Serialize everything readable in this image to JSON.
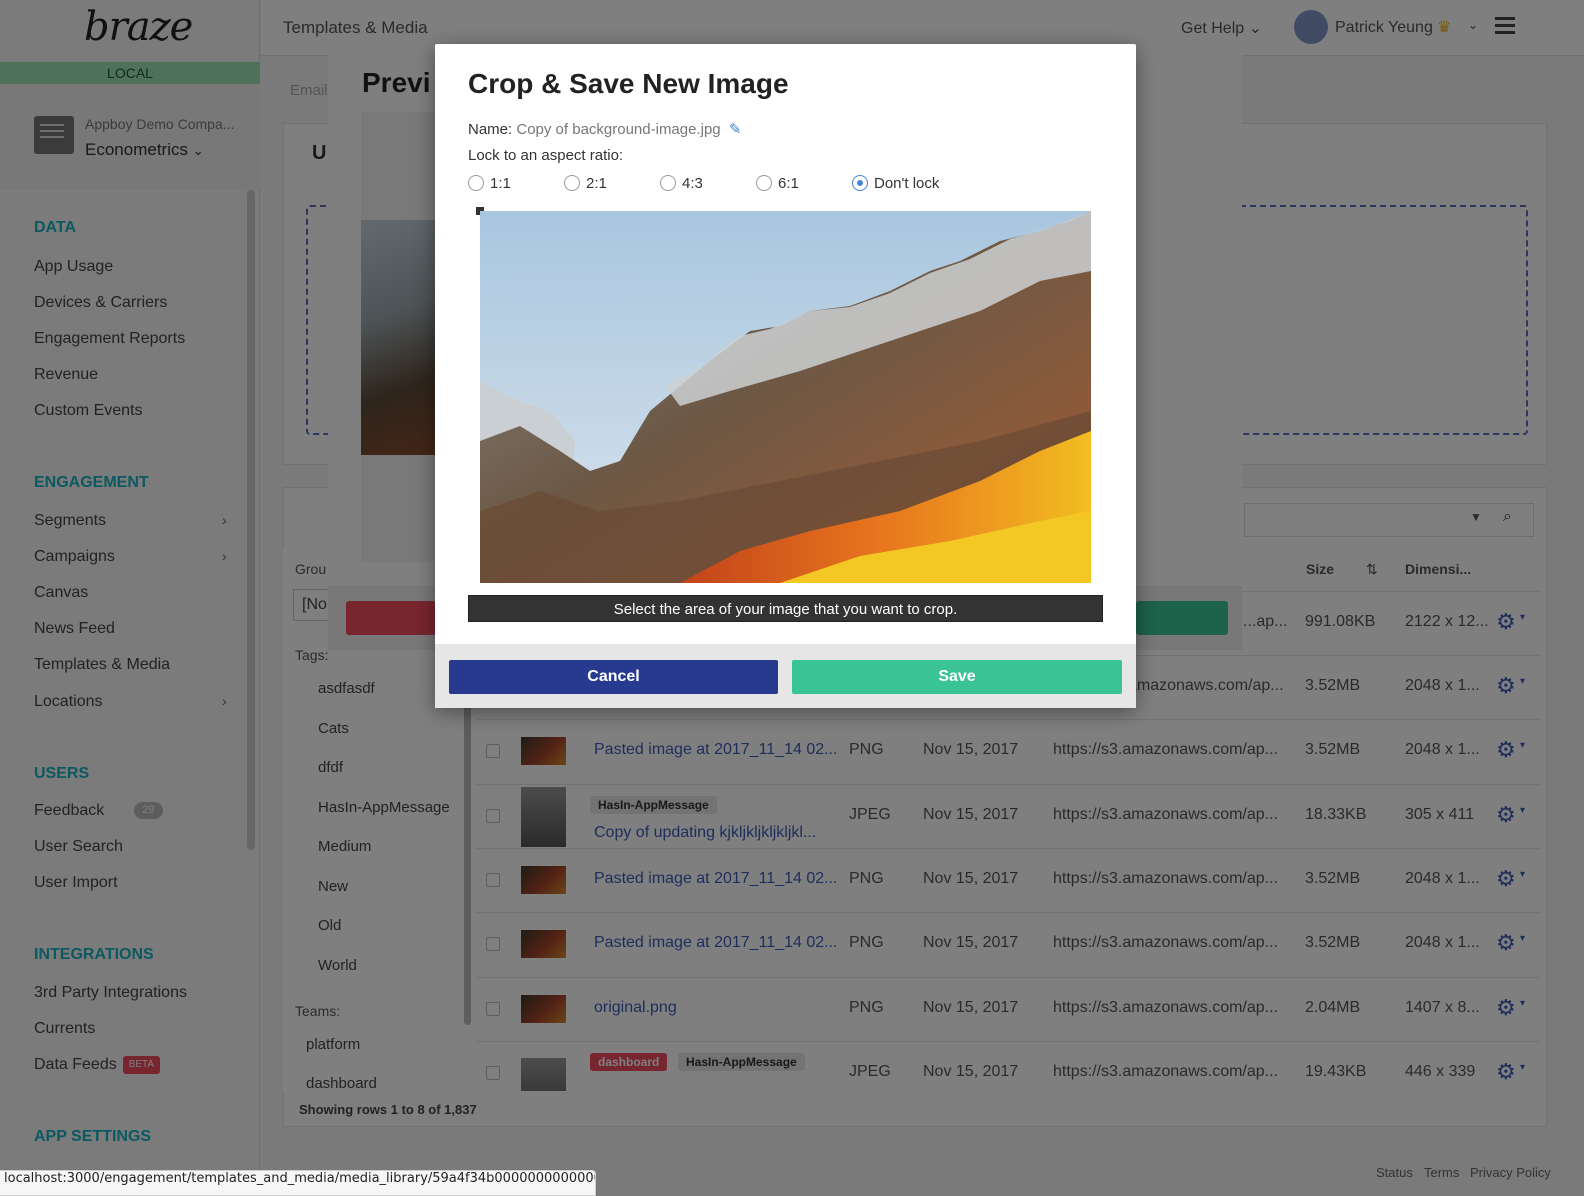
{
  "app": {
    "logo": "braze",
    "environment": "LOCAL",
    "company_sub": "Appboy Demo Compa...",
    "company_name": "Econometrics",
    "chevron": "⌄"
  },
  "sidebar": {
    "sections": [
      {
        "title": "DATA",
        "items": [
          {
            "label": "App Usage"
          },
          {
            "label": "Devices & Carriers"
          },
          {
            "label": "Engagement Reports"
          },
          {
            "label": "Revenue"
          },
          {
            "label": "Custom Events"
          }
        ]
      },
      {
        "title": "ENGAGEMENT",
        "items": [
          {
            "label": "Segments",
            "chevron": "›"
          },
          {
            "label": "Campaigns",
            "chevron": "›"
          },
          {
            "label": "Canvas"
          },
          {
            "label": "News Feed"
          },
          {
            "label": "Templates & Media"
          },
          {
            "label": "Locations",
            "chevron": "›"
          }
        ]
      },
      {
        "title": "USERS",
        "items": [
          {
            "label": "Feedback",
            "badge": "29"
          },
          {
            "label": "User Search"
          },
          {
            "label": "User Import"
          }
        ]
      },
      {
        "title": "INTEGRATIONS",
        "items": [
          {
            "label": "3rd Party Integrations"
          },
          {
            "label": "Currents"
          },
          {
            "label": "Data Feeds",
            "badge": "BETA"
          }
        ]
      },
      {
        "title": "APP SETTINGS",
        "items": []
      }
    ]
  },
  "header": {
    "title": "Templates & Media",
    "get_help": "Get Help ⌄",
    "user_name": "Patrick Yeung",
    "crown_icon": "♛",
    "user_chevron": "⌄"
  },
  "background_page": {
    "email_tab": "Email",
    "preview_title": "Previ",
    "upload_fragment": "U",
    "group_label": "Grou",
    "group_value": "[No",
    "tags_label": "Tags:",
    "tags": [
      "asdfasdf",
      "Cats",
      "dfdf",
      "HasIn-AppMessage",
      "Medium",
      "New",
      "Old",
      "World"
    ],
    "teams_label": "Teams:",
    "teams": [
      "platform",
      "dashboard"
    ],
    "columns": {
      "size": "Size",
      "size_sort_icon": "⇅",
      "dimensions": "Dimensi..."
    },
    "rows": [
      {
        "name": "",
        "type": "",
        "date": "",
        "url": "...ap...",
        "size": "991.08KB",
        "dim": "2122 x 12...",
        "thumb": "none"
      },
      {
        "name": "",
        "type": "",
        "date": "",
        "url": "amazonaws.com/ap...",
        "size": "3.52MB",
        "dim": "2048 x 1...",
        "thumb": "none"
      },
      {
        "name": "Pasted image at 2017_11_14 02...",
        "type": "PNG",
        "date": "Nov 15, 2017",
        "url": "https://s3.amazonaws.com/ap...",
        "size": "3.52MB",
        "dim": "2048 x 1...",
        "thumb": "color"
      },
      {
        "name": "Copy of updating kjkljkljkljkljkl...",
        "tag1": "HasIn-AppMessage",
        "type": "JPEG",
        "date": "Nov 15, 2017",
        "url": "https://s3.amazonaws.com/ap...",
        "size": "18.33KB",
        "dim": "305 x 411",
        "thumb": "gray"
      },
      {
        "name": "Pasted image at 2017_11_14 02...",
        "type": "PNG",
        "date": "Nov 15, 2017",
        "url": "https://s3.amazonaws.com/ap...",
        "size": "3.52MB",
        "dim": "2048 x 1...",
        "thumb": "color"
      },
      {
        "name": "Pasted image at 2017_11_14 02...",
        "type": "PNG",
        "date": "Nov 15, 2017",
        "url": "https://s3.amazonaws.com/ap...",
        "size": "3.52MB",
        "dim": "2048 x 1...",
        "thumb": "color"
      },
      {
        "name": "original.png",
        "type": "PNG",
        "date": "Nov 15, 2017",
        "url": "https://s3.amazonaws.com/ap...",
        "size": "2.04MB",
        "dim": "1407 x 8...",
        "thumb": "color"
      },
      {
        "name": "",
        "tag1": "dashboard",
        "tag2": "HasIn-AppMessage",
        "type": "JPEG",
        "date": "Nov 15, 2017",
        "url": "https://s3.amazonaws.com/ap...",
        "size": "19.43KB",
        "dim": "446 x 339",
        "thumb": "gray"
      }
    ],
    "gear_icon": "⚙",
    "gear_chevron": "▾",
    "showing": "Showing rows 1 to 8 of 1,837"
  },
  "footer": {
    "status": "Status",
    "terms": "Terms",
    "privacy": "Privacy Policy"
  },
  "status_url": "localhost:3000/engagement/templates_and_media/media_library/59a4f34b0000000000000000#",
  "modal": {
    "title": "Crop & Save New Image",
    "name_label": "Name:",
    "name_value": "Copy of background-image.jpg",
    "pencil_icon": "✎",
    "lock_label": "Lock to an aspect ratio:",
    "ratios": [
      {
        "label": "1:1",
        "selected": false
      },
      {
        "label": "2:1",
        "selected": false
      },
      {
        "label": "4:3",
        "selected": false
      },
      {
        "label": "6:1",
        "selected": false
      },
      {
        "label": "Don't lock",
        "selected": true
      }
    ],
    "hint": "Select the area of your image that you want to crop.",
    "cancel_label": "Cancel",
    "save_label": "Save"
  },
  "colors": {
    "accent_teal": "#17b3c3",
    "cancel_blue": "#283a8f",
    "save_green": "#3ac496",
    "link_blue": "#3e5bb8",
    "beta_red": "#ef4a5f"
  }
}
